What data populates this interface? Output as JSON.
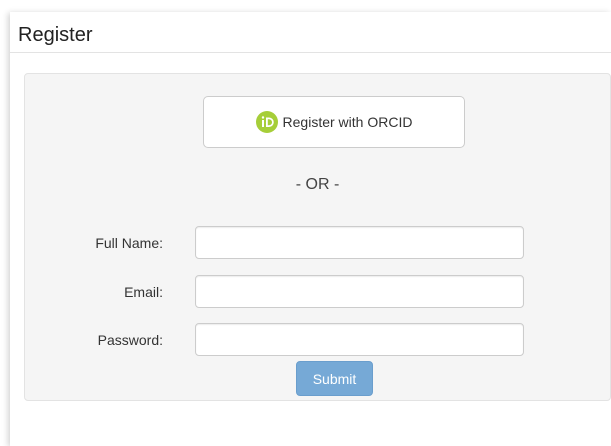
{
  "heading": {
    "title": "Register"
  },
  "orcid": {
    "button_label": "Register with ORCID",
    "icon": "orcid-icon",
    "icon_color": "#a6ce39"
  },
  "divider_text": "- OR -",
  "form": {
    "fields": [
      {
        "label": "Full Name:",
        "value": "",
        "placeholder": ""
      },
      {
        "label": "Email:",
        "value": "",
        "placeholder": ""
      },
      {
        "label": "Password:",
        "value": "",
        "placeholder": ""
      }
    ],
    "submit_label": "Submit"
  },
  "colors": {
    "submit_bg": "#76a9d6",
    "well_bg": "#f5f5f5"
  }
}
